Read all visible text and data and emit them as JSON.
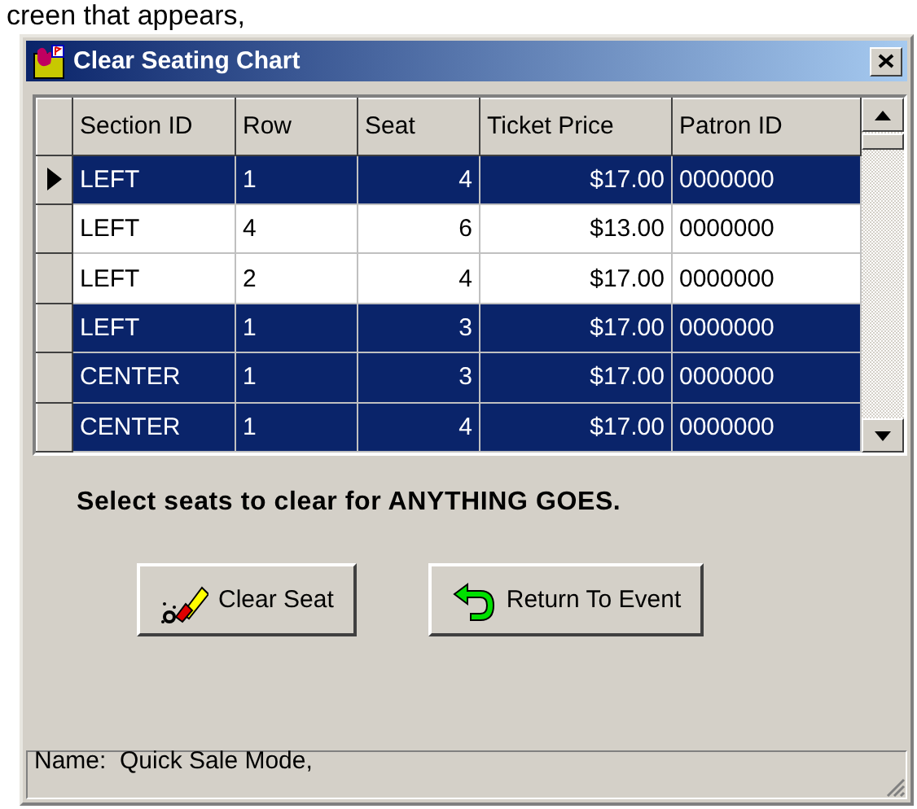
{
  "caption": "creen that appears,",
  "window": {
    "title": "Clear Seating Chart"
  },
  "table": {
    "columns": [
      "Section ID",
      "Row",
      "Seat",
      "Ticket Price",
      "Patron ID"
    ],
    "rows": [
      {
        "cells": [
          "LEFT",
          "1",
          "4",
          "$17.00",
          "0000000"
        ],
        "selected": true,
        "current": true
      },
      {
        "cells": [
          "LEFT",
          "4",
          "6",
          "$13.00",
          "0000000"
        ],
        "selected": false,
        "current": false
      },
      {
        "cells": [
          "LEFT",
          "2",
          "4",
          "$17.00",
          "0000000"
        ],
        "selected": false,
        "current": false
      },
      {
        "cells": [
          "LEFT",
          "1",
          "3",
          "$17.00",
          "0000000"
        ],
        "selected": true,
        "current": false
      },
      {
        "cells": [
          "CENTER",
          "1",
          "3",
          "$17.00",
          "0000000"
        ],
        "selected": true,
        "current": false
      },
      {
        "cells": [
          "CENTER",
          "1",
          "4",
          "$17.00",
          "0000000"
        ],
        "selected": true,
        "current": false
      }
    ]
  },
  "message": "Select seats to clear for ANYTHING GOES.",
  "buttons": [
    {
      "label": "Clear Seat",
      "kind": "clear"
    },
    {
      "label": "Return To Event",
      "kind": "return"
    }
  ],
  "status_bar": "Name:  Quick Sale Mode,"
}
